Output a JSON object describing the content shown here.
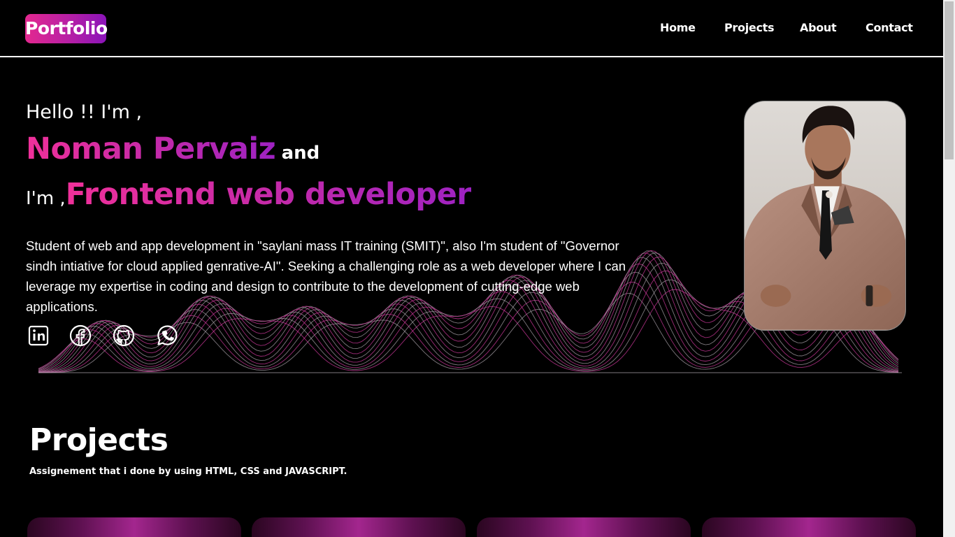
{
  "header": {
    "logo": "Portfolio",
    "nav": [
      {
        "label": "Home"
      },
      {
        "label": "Projects"
      },
      {
        "label": "About"
      },
      {
        "label": "Contact"
      }
    ]
  },
  "hero": {
    "greeting": "Hello !! I'm ,",
    "name": "Noman Pervaiz",
    "and_text": "and",
    "im_text": "I'm ,",
    "role": "Frontend web developer",
    "bio": "Student of web and app development in \"saylani mass IT training (SMIT)\", also I'm student of \"Governor sindh intiative for cloud applied genrative-AI\". Seeking a challenging role as a web developer where I can leverage my expertise in coding and design to contribute to the development of cutting-edge web applications.",
    "socials": [
      {
        "icon": "linkedin-icon"
      },
      {
        "icon": "facebook-icon"
      },
      {
        "icon": "github-icon"
      },
      {
        "icon": "whatsapp-icon"
      }
    ],
    "accent_gradient": [
      "#f0309a",
      "#9e22c2"
    ]
  },
  "projects": {
    "title": "Projects",
    "subtitle": "Assignement that i done by using HTML, CSS and JAVASCRIPT."
  },
  "colors": {
    "background": "#000000",
    "text": "#ffffff",
    "accent_pink": "#e3288f",
    "accent_purple": "#8a14b8"
  }
}
